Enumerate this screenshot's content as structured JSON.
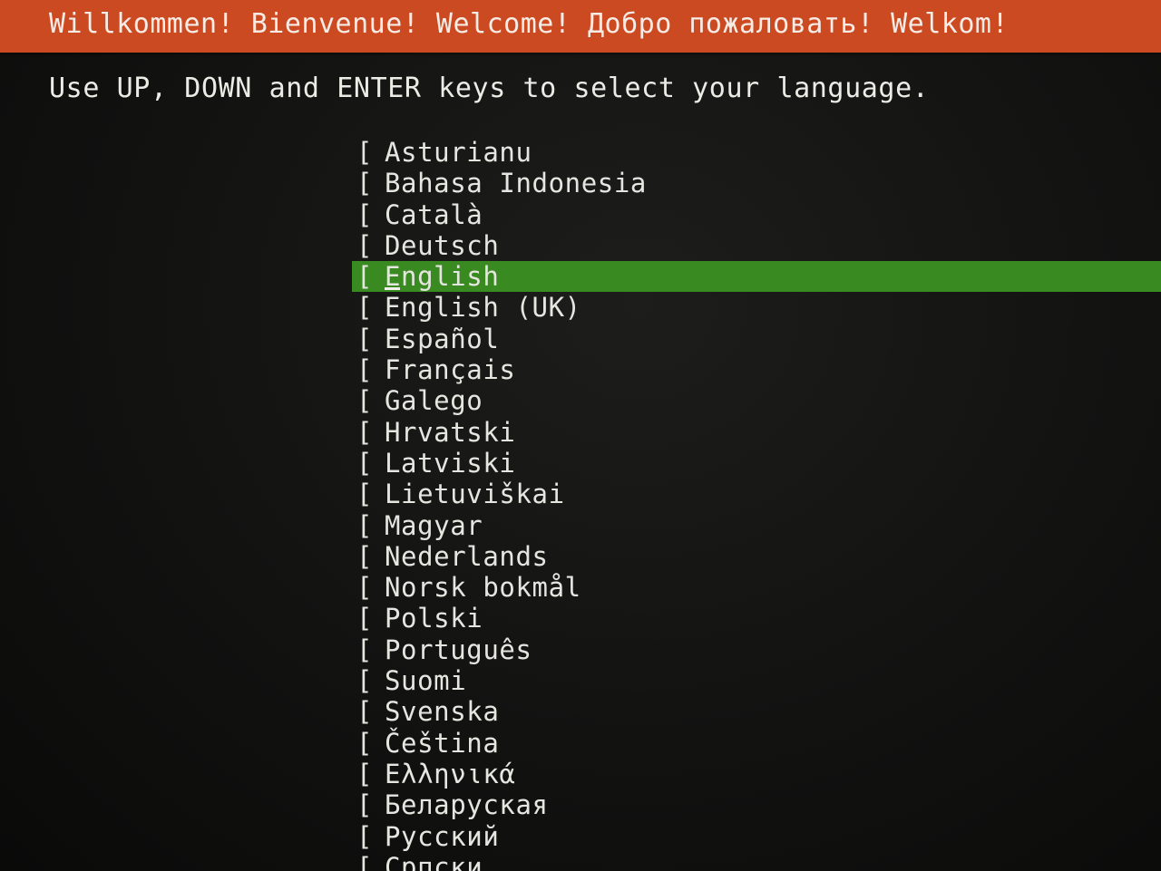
{
  "header": {
    "title": "Willkommen! Bienvenue! Welcome! Добро пожаловать! Welkom!",
    "color": "#cc4a22"
  },
  "instructions": "Use UP, DOWN and ENTER keys to select your language.",
  "language_list": {
    "bracket": "[",
    "selected_index": 4,
    "highlight_color": "#3a8a22",
    "items": [
      {
        "label": "Asturianu"
      },
      {
        "label": "Bahasa Indonesia"
      },
      {
        "label": "Català"
      },
      {
        "label": "Deutsch"
      },
      {
        "label": "English"
      },
      {
        "label": "English (UK)"
      },
      {
        "label": "Español"
      },
      {
        "label": "Français"
      },
      {
        "label": "Galego"
      },
      {
        "label": "Hrvatski"
      },
      {
        "label": "Latviski"
      },
      {
        "label": "Lietuviškai"
      },
      {
        "label": "Magyar"
      },
      {
        "label": "Nederlands"
      },
      {
        "label": "Norsk bokmål"
      },
      {
        "label": "Polski"
      },
      {
        "label": "Português"
      },
      {
        "label": "Suomi"
      },
      {
        "label": "Svenska"
      },
      {
        "label": "Čeština"
      },
      {
        "label": "Ελληνικά"
      },
      {
        "label": "Беларуская"
      },
      {
        "label": "Русский"
      },
      {
        "label": "Српски"
      }
    ]
  }
}
